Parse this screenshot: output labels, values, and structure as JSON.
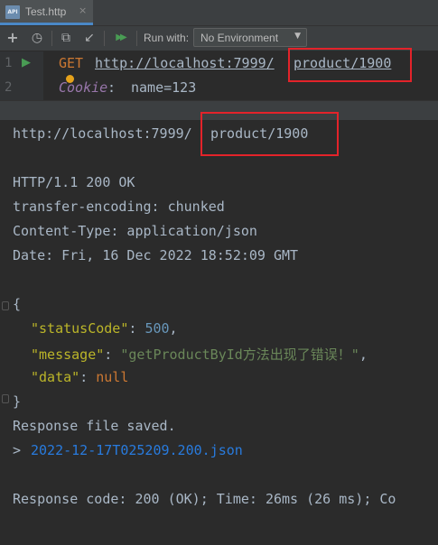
{
  "tab": {
    "icon_text": "API",
    "label": "Test.http",
    "close": "×"
  },
  "toolbar": {
    "add": "+",
    "history": "◷",
    "copy": "⧉",
    "import": "↙",
    "run_all": "▶▶",
    "run_with_label": "Run with:",
    "environment_value": "No Environment",
    "arrow": "▼"
  },
  "editor": {
    "lines": [
      {
        "num": "1",
        "method": "GET",
        "url_host": "http://localhost:7999/",
        "url_path": "product/1900"
      },
      {
        "num": "2",
        "header_name": "Cookie",
        "header_sep": ": ",
        "header_value": "name=123"
      }
    ]
  },
  "response": {
    "url_host": "http://localhost:7999/",
    "url_path": "product/1900",
    "status_line": "HTTP/1.1 200 OK",
    "header1": "transfer-encoding: chunked",
    "header2": "Content-Type: application/json",
    "header3": "Date: Fri, 16 Dec 2022 18:52:09 GMT",
    "open_brace": "{",
    "status_key": "\"statusCode\"",
    "status_val": "500",
    "message_key": "\"message\"",
    "message_val": "\"getProductById方法出现了错误！\"",
    "data_key": "\"data\"",
    "data_val": "null",
    "close_brace": "}",
    "saved_text": "Response file saved.",
    "file_prefix": "> ",
    "file_link": "2022-12-17T025209.200.json",
    "summary": "Response code: 200 (OK); Time: 26ms (26 ms); Co"
  },
  "colors": {
    "highlight_box": "#e3232a",
    "json_key": "#bbb529",
    "json_number": "#6897bb",
    "json_string": "#6a8759",
    "keyword": "#cc7832"
  }
}
